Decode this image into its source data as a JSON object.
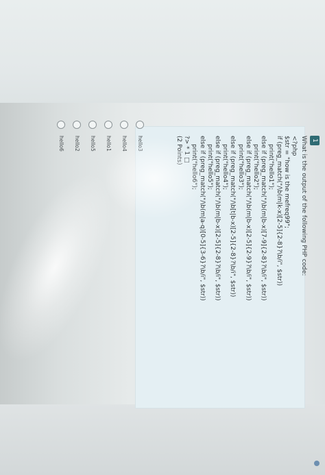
{
  "question": {
    "number": "1",
    "prompt": "What is the output of the following PHP code:",
    "code_lines": [
      {
        "text": "<?php",
        "indent": false
      },
      {
        "text": "$str  =  \"how is the mefreq99\";",
        "indent": false
      },
      {
        "text": "if (preg_match(\"/\\b(m|k-x)[2-5]{2-8}?\\b/i\", $str))",
        "indent": false
      },
      {
        "text": "print(\"hello1\");",
        "indent": true
      },
      {
        "text": "else if (preg_match(\"/\\b(m|b-x)[7-9]{2-8}?\\b/i\", $str))",
        "indent": false
      },
      {
        "text": "print(\"hello2\");",
        "indent": true
      },
      {
        "text": "else if (preg_match(\"/\\b(m|b-x)[2-5]{2-9}?\\b/i\", $str))",
        "indent": false
      },
      {
        "text": "print(\"hello3\");",
        "indent": true
      },
      {
        "text": "else if (preg_match(\"/\\b[t|b-x)[2-5]{2-8}?\\b/i\", $str))",
        "indent": false
      },
      {
        "text": "print(\"hello4\");",
        "indent": true
      },
      {
        "text": "else if (preg_match(\"/\\b(m|b-x)[2-5]{2-8}?\\b/i\", $str))",
        "indent": false
      },
      {
        "text": "print(\"hello5\");",
        "indent": true
      },
      {
        "text": "else if (preg_match(\"/\\b(m|a-q)[0-5]{3-6}?\\b/i\", $str))",
        "indent": false
      },
      {
        "text": "print(\"hello6\");",
        "indent": true
      },
      {
        "text": "?>  *  1 □",
        "indent": false
      },
      {
        "text": "(2 Points)",
        "indent": false
      }
    ]
  },
  "options": [
    "hello3",
    "hello4",
    "hello1",
    "hello5",
    "hello2",
    "hello6"
  ]
}
